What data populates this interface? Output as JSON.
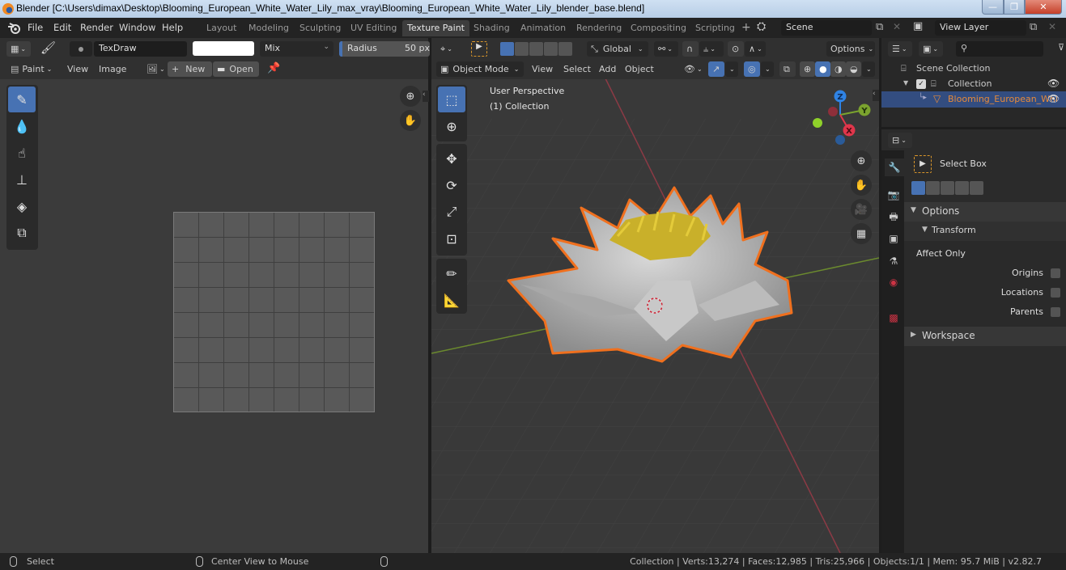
{
  "window": {
    "title": "Blender [C:\\Users\\dimax\\Desktop\\Blooming_European_White_Water_Lily_max_vray\\Blooming_European_White_Water_Lily_blender_base.blend]",
    "controls": {
      "minimize": "—",
      "maximize": "❐",
      "close": "✕"
    }
  },
  "menu": [
    "File",
    "Edit",
    "Render",
    "Window",
    "Help"
  ],
  "workspaces": {
    "tabs": [
      "Layout",
      "Modeling",
      "Sculpting",
      "UV Editing",
      "Texture Paint",
      "Shading",
      "Animation",
      "Rendering",
      "Compositing",
      "Scripting"
    ],
    "active": "Texture Paint",
    "add": "+"
  },
  "scene": {
    "value": "Scene"
  },
  "view_layer": {
    "value": "View Layer"
  },
  "image_editor": {
    "brush_name": "TexDraw",
    "color_hex": "#ffffff",
    "blend_mode": "Mix",
    "radius_label": "Radius",
    "radius_value": "50 px",
    "mode_label": "Paint",
    "menus": [
      "View",
      "Image"
    ],
    "new_label": "New",
    "open_label": "Open",
    "tools": [
      "draw-brush-icon",
      "soften-icon",
      "smear-icon",
      "clone-stamp-icon",
      "fill-icon",
      "mask-icon"
    ]
  },
  "viewport": {
    "transform_orientation": "Global",
    "options_label": "Options",
    "mode": "Object Mode",
    "menus": [
      "View",
      "Select",
      "Add",
      "Object"
    ],
    "overlay_text": [
      "User Perspective",
      "(1) Collection"
    ],
    "gizmo_axes": [
      "Z",
      "Y",
      "X"
    ],
    "axis_colors": {
      "x": "#e0364b",
      "y": "#7ba32e",
      "z": "#2f83e4"
    },
    "selection_outline": "#f0701e",
    "shading_active": "solid"
  },
  "outliner": {
    "search_placeholder": "",
    "root": "Scene Collection",
    "collection": "Collection",
    "object": "Blooming_European_Whi",
    "object_color": "#e68a3a"
  },
  "properties": {
    "tool_name": "Select Box",
    "options_label": "Options",
    "transform_label": "Transform",
    "affect_only_label": "Affect Only",
    "checkboxes": [
      {
        "label": "Origins",
        "checked": false
      },
      {
        "label": "Locations",
        "checked": false
      },
      {
        "label": "Parents",
        "checked": false
      }
    ],
    "workspace_label": "Workspace"
  },
  "statusbar": {
    "left_action": "Select",
    "middle_action": "Center View to Mouse",
    "stats": "Collection | Verts:13,274 | Faces:12,985 | Tris:25,966 | Objects:1/1 | Mem: 95.7 MiB | v2.82.7"
  }
}
